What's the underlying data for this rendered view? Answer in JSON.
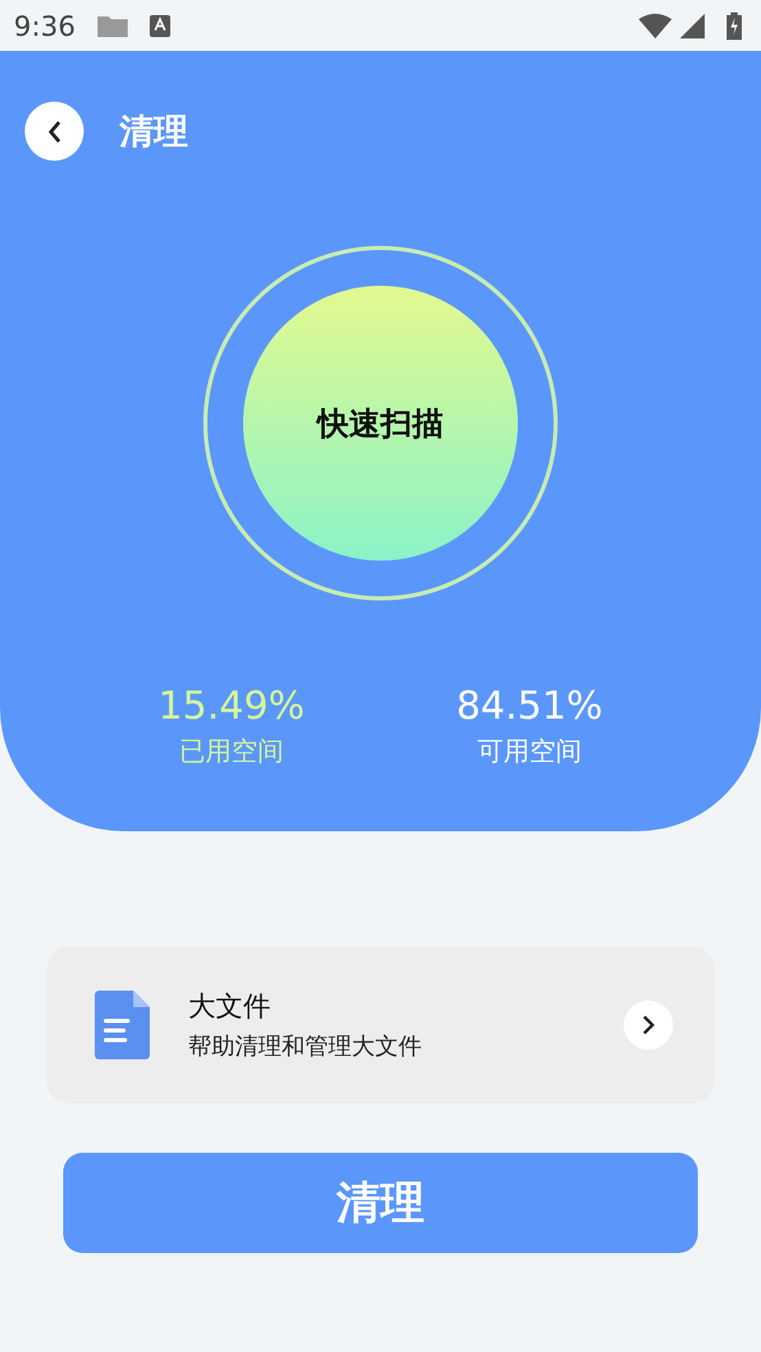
{
  "status_bar": {
    "time": "9:36"
  },
  "header": {
    "title": "清理"
  },
  "scan": {
    "label": "快速扫描"
  },
  "stats": [
    {
      "value": "15.49%",
      "label": "已用空间",
      "color": "#d6f59a"
    },
    {
      "value": "84.51%",
      "label": "可用空间",
      "color": "#ffffff"
    }
  ],
  "card": {
    "title": "大文件",
    "subtitle": "帮助清理和管理大文件"
  },
  "button": {
    "label": "清理"
  }
}
